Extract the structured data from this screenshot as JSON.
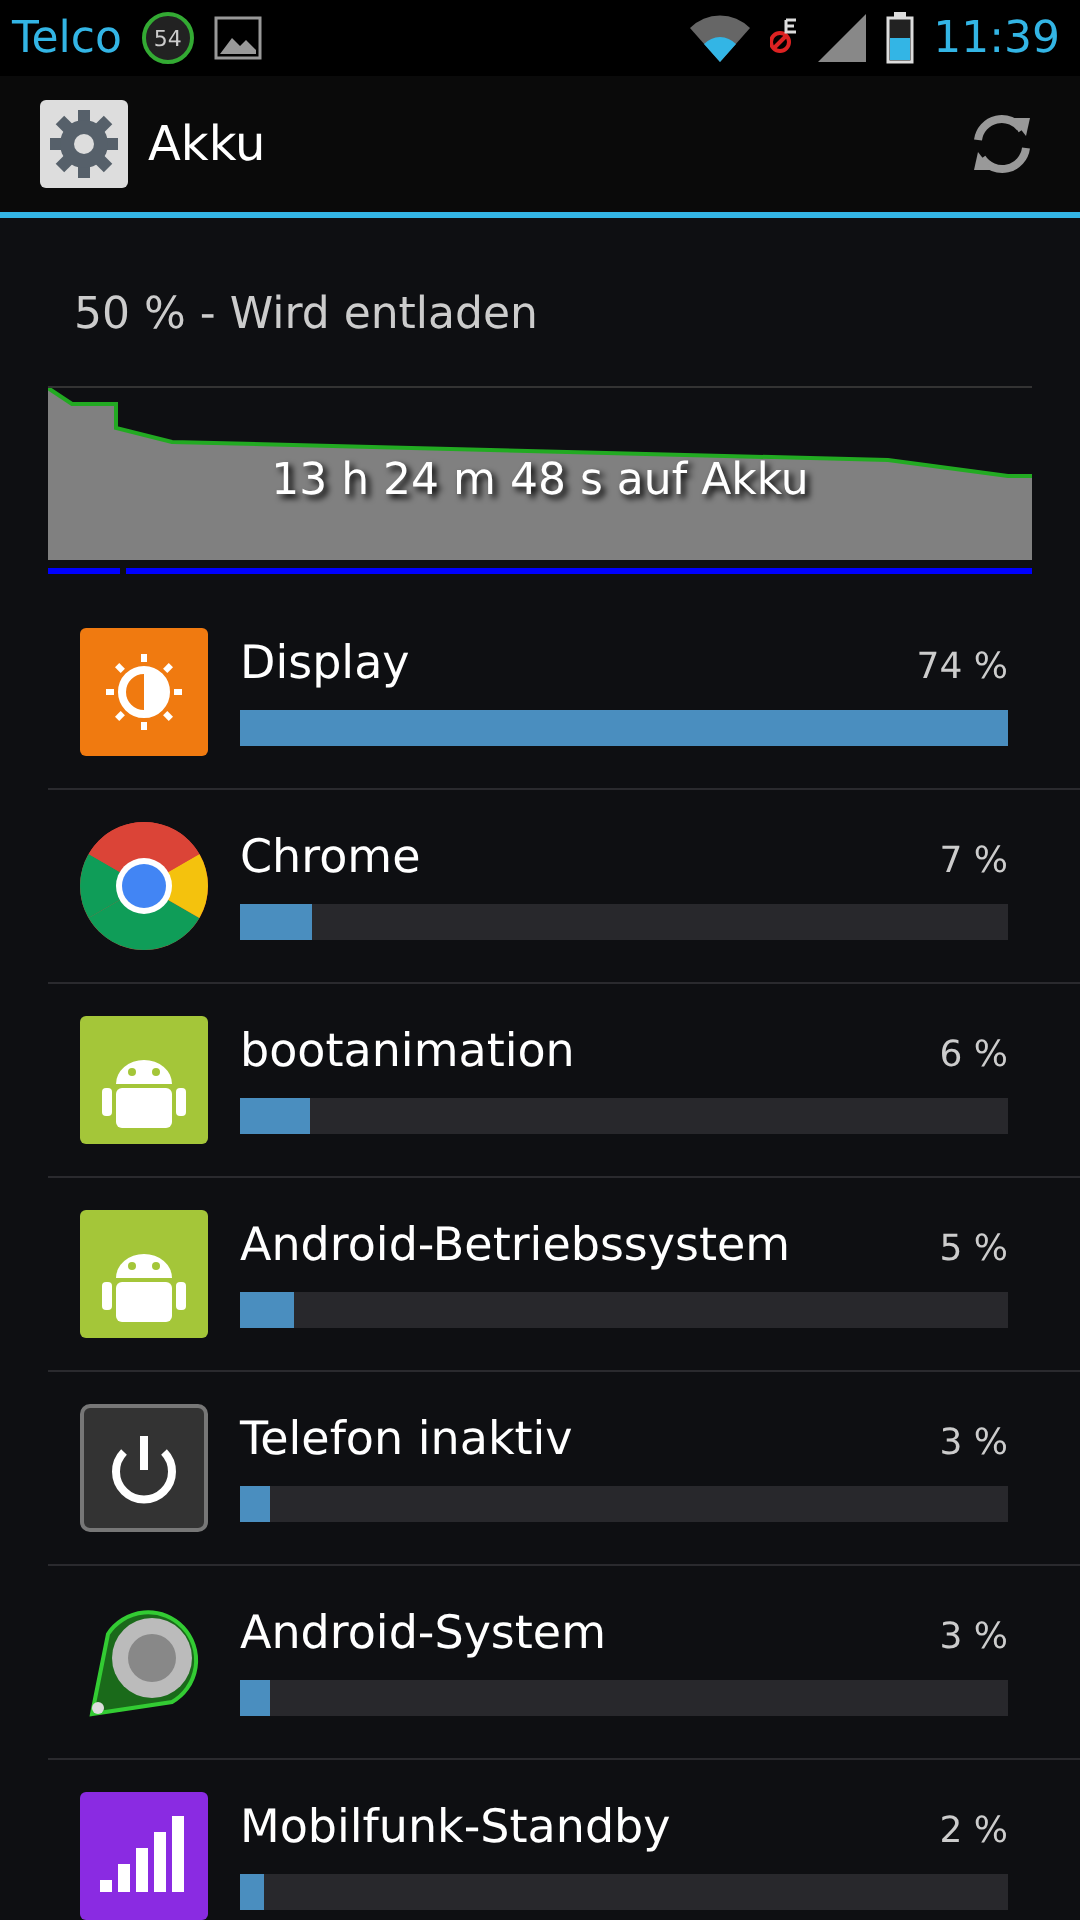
{
  "status_bar": {
    "carrier": "Telco",
    "badge": "54",
    "time": "11:39"
  },
  "action_bar": {
    "title": "Akku"
  },
  "summary": "50 % - Wird entladen",
  "graph": {
    "caption": "13 h 24 m 48 s auf Akku"
  },
  "apps": [
    {
      "name": "Display",
      "percent": "74 %",
      "level": 1.0,
      "kind": "display"
    },
    {
      "name": "Chrome",
      "percent": "7 %",
      "level": 0.095,
      "kind": "chrome"
    },
    {
      "name": "bootanimation",
      "percent": "6 %",
      "level": 0.09,
      "kind": "android"
    },
    {
      "name": "Android-Betriebssystem",
      "percent": "5 %",
      "level": 0.07,
      "kind": "android"
    },
    {
      "name": "Telefon inaktiv",
      "percent": "3 %",
      "level": 0.04,
      "kind": "power"
    },
    {
      "name": "Android-System",
      "percent": "3 %",
      "level": 0.04,
      "kind": "system"
    },
    {
      "name": "Mobilfunk-Standby",
      "percent": "2 %",
      "level": 0.03,
      "kind": "signal"
    }
  ]
}
